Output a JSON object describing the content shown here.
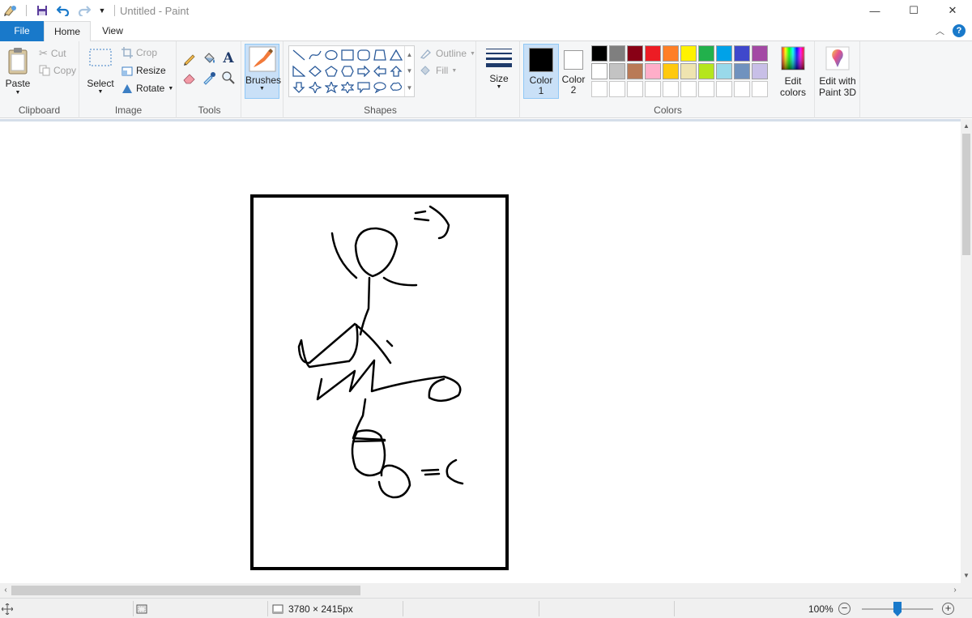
{
  "window": {
    "title": "Untitled - Paint",
    "minimize_glyph": "—",
    "maximize_glyph": "☐",
    "close_glyph": "✕"
  },
  "tabs": {
    "file": "File",
    "home": "Home",
    "view": "View"
  },
  "ribbon": {
    "clipboard": {
      "group_label": "Clipboard",
      "paste": "Paste",
      "cut": "Cut",
      "copy": "Copy"
    },
    "image": {
      "group_label": "Image",
      "select": "Select",
      "crop": "Crop",
      "resize": "Resize",
      "rotate": "Rotate"
    },
    "tools": {
      "group_label": "Tools"
    },
    "brushes": {
      "label": "Brushes"
    },
    "shapes": {
      "group_label": "Shapes",
      "outline": "Outline",
      "fill": "Fill"
    },
    "size": {
      "label": "Size"
    },
    "colors": {
      "group_label": "Colors",
      "color1_label": "Color",
      "color1_num": "1",
      "color1_value": "#000000",
      "color2_label": "Color",
      "color2_num": "2",
      "color2_value": "#ffffff",
      "edit_colors_line1": "Edit",
      "edit_colors_line2": "colors",
      "palette_row1": [
        "#000000",
        "#7f7f7f",
        "#880015",
        "#ed1c24",
        "#ff7f27",
        "#fff200",
        "#22b14c",
        "#00a2e8",
        "#3f48cc",
        "#a349a4"
      ],
      "palette_row2": [
        "#ffffff",
        "#c3c3c3",
        "#b97a57",
        "#ffaec9",
        "#ffc90e",
        "#efe4b0",
        "#b5e61d",
        "#99d9ea",
        "#7092be",
        "#c8bfe7"
      ],
      "palette_row3": [
        "#ffffff",
        "#ffffff",
        "#ffffff",
        "#ffffff",
        "#ffffff",
        "#ffffff",
        "#ffffff",
        "#ffffff",
        "#ffffff",
        "#ffffff"
      ]
    },
    "paint3d": {
      "line1": "Edit with",
      "line2": "Paint 3D"
    }
  },
  "status": {
    "canvas_size": "3780 × 2415px",
    "zoom": "100%",
    "zoom_fraction": 0.5
  }
}
